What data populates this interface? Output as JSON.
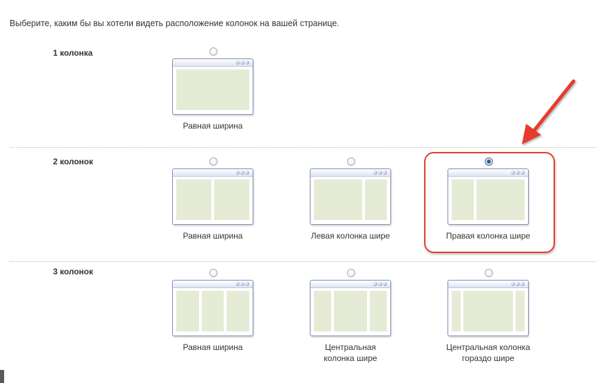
{
  "instructions": "Выберите, каким бы вы хотели видеть расположение колонок на вашей странице.",
  "sections": [
    {
      "label": "1 колонка",
      "options": [
        {
          "caption": "Равная ширина",
          "selected": false
        }
      ]
    },
    {
      "label": "2 колонок",
      "options": [
        {
          "caption": "Равная ширина",
          "selected": false
        },
        {
          "caption": "Левая колонка шире",
          "selected": false
        },
        {
          "caption": "Правая колонка шире",
          "selected": true
        }
      ]
    },
    {
      "label": "3 колонок",
      "options": [
        {
          "caption": "Равная ширина",
          "selected": false
        },
        {
          "caption": "Центральная колонка шире",
          "selected": false
        },
        {
          "caption": "Центральная колонка гораздо шире",
          "selected": false
        }
      ]
    }
  ],
  "colors": {
    "highlight": "#e63a2e",
    "column_fill": "#e5ebd5",
    "window_border": "#7f8bb1"
  }
}
